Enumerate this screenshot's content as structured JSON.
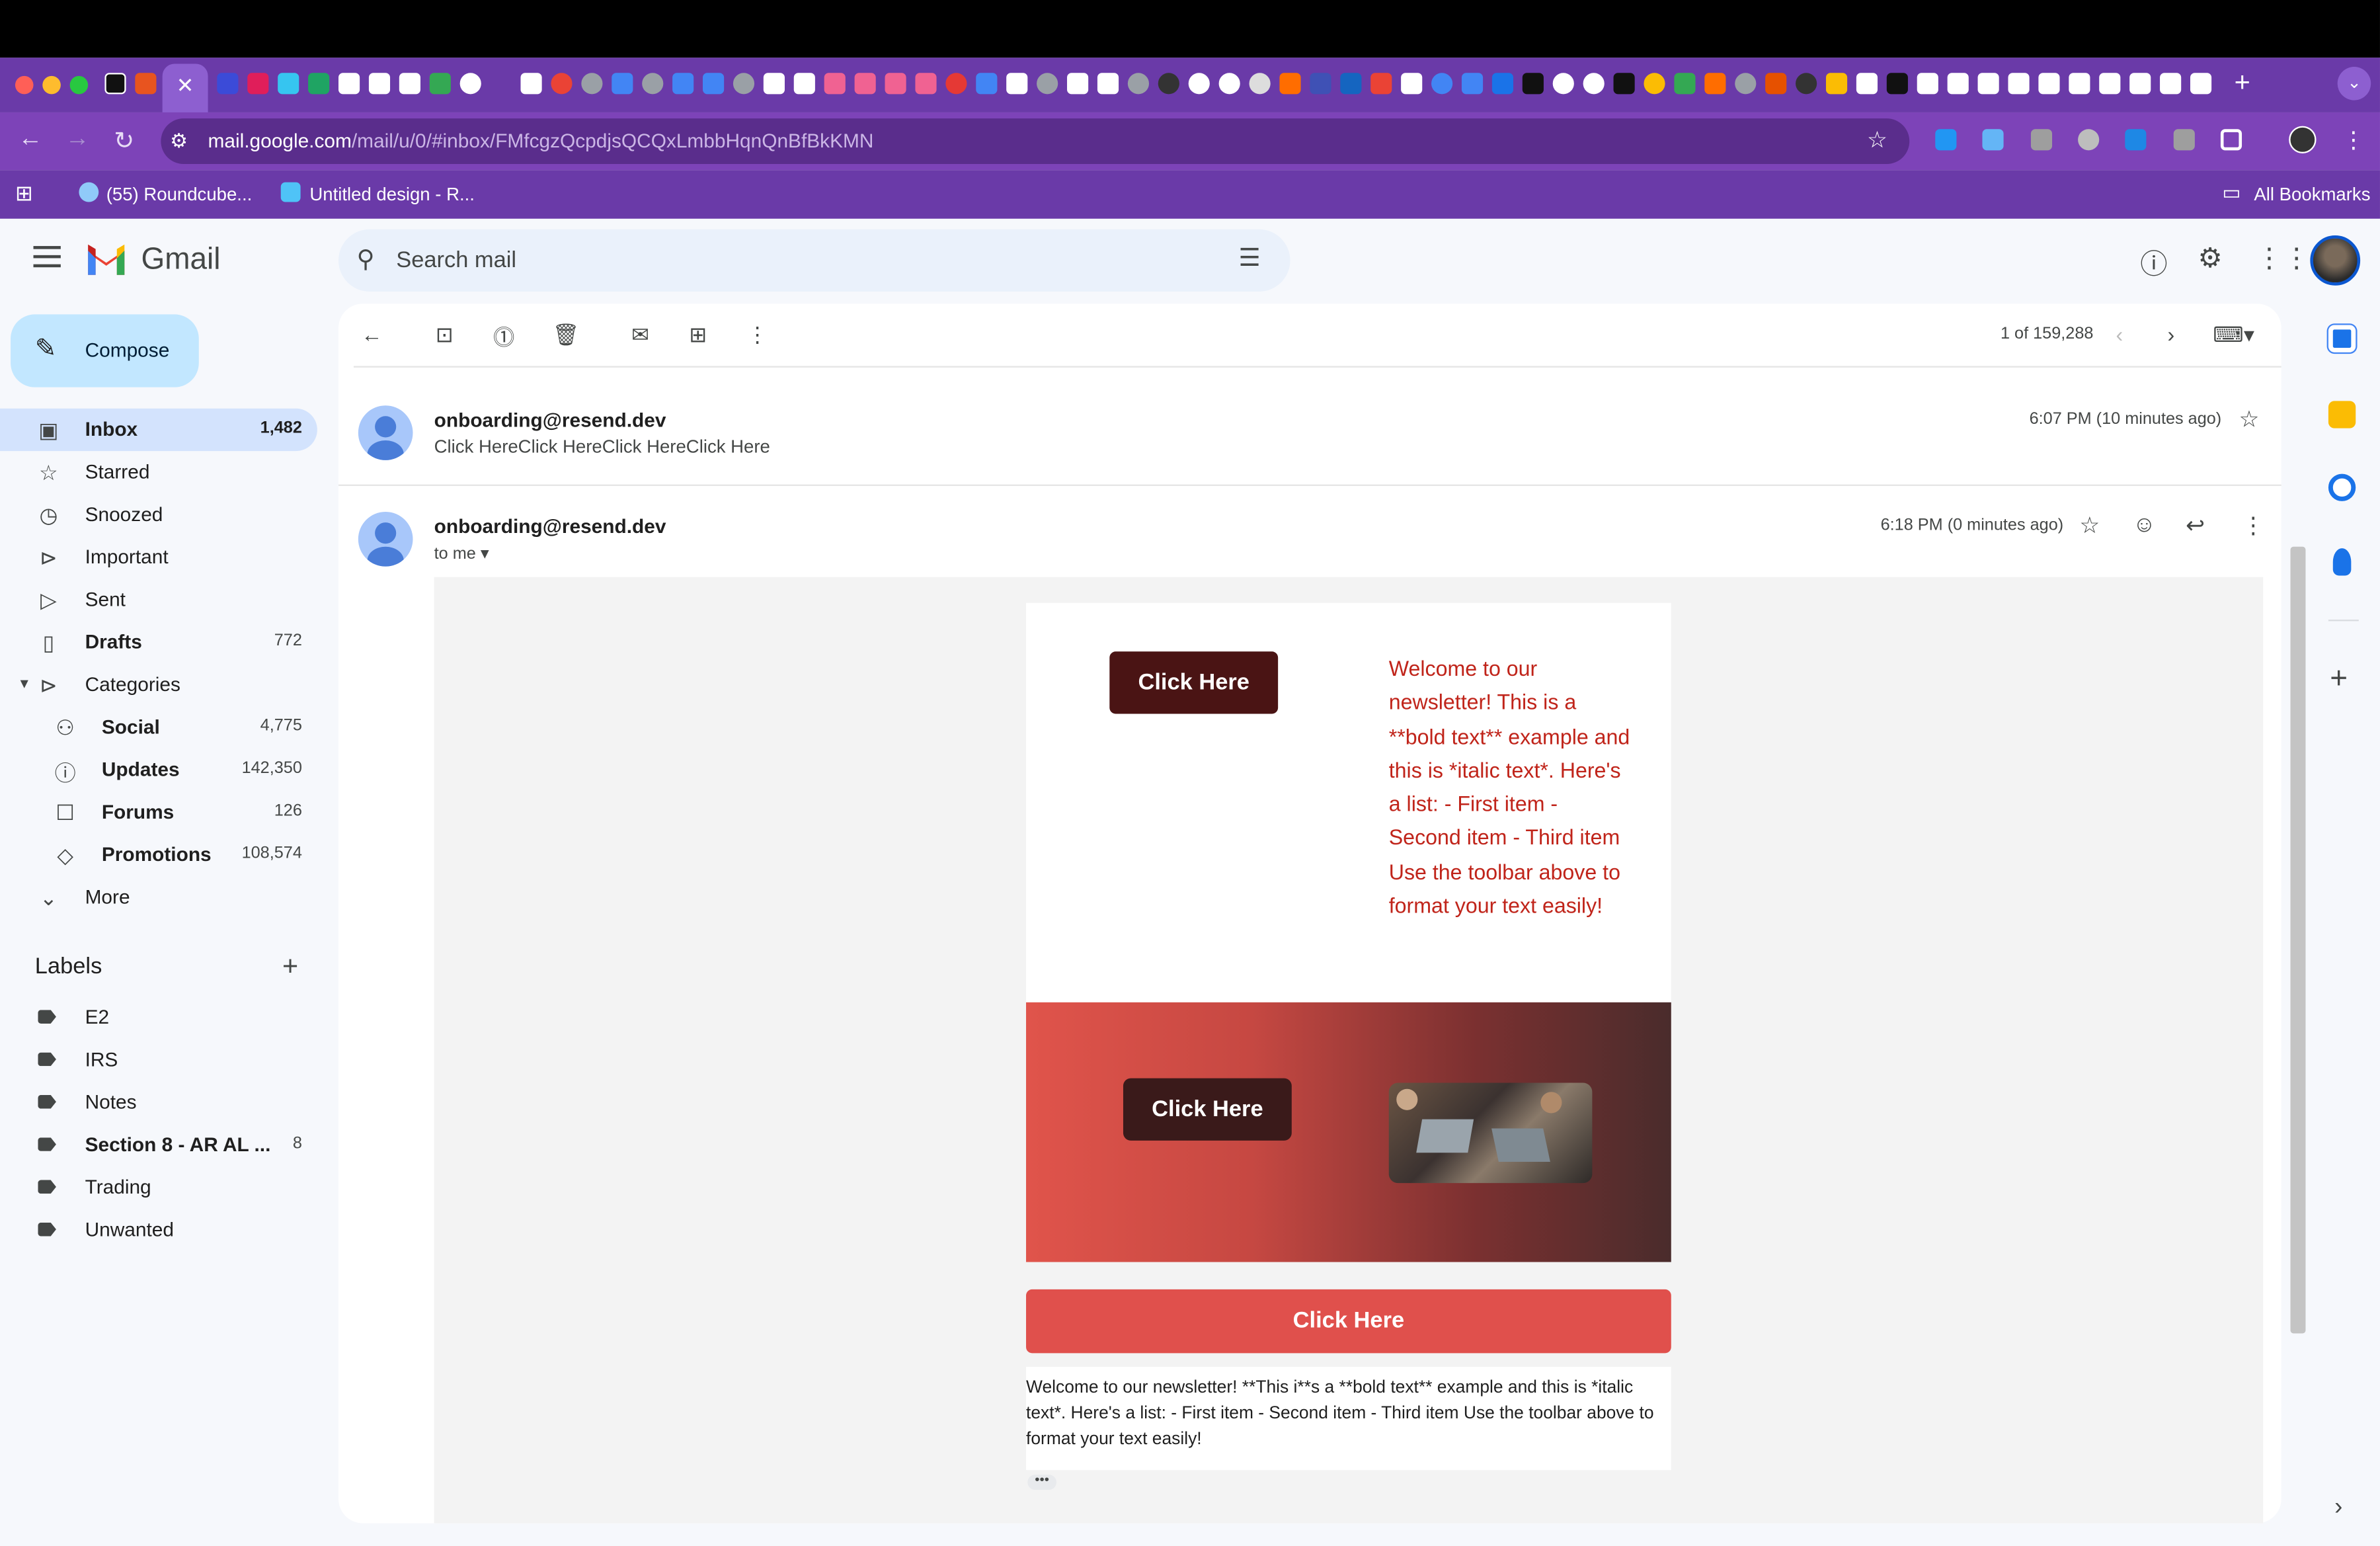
{
  "browser": {
    "active_tab_close": "✕",
    "new_tab": "+",
    "url_host": "mail.google.com",
    "url_path": "/mail/u/0/#inbox/FMfcgzQcpdjsQCQxLmbbHqnQnBfBkKMN",
    "bookmarks": [
      "(55) Roundcube...",
      "Untitled design - R..."
    ],
    "all_bookmarks": "All Bookmarks"
  },
  "gmail": {
    "brand": "Gmail",
    "search_placeholder": "Search mail",
    "compose": "Compose"
  },
  "sidebar": {
    "items": [
      {
        "label": "Inbox",
        "count": "1,482"
      },
      {
        "label": "Starred",
        "count": ""
      },
      {
        "label": "Snoozed",
        "count": ""
      },
      {
        "label": "Important",
        "count": ""
      },
      {
        "label": "Sent",
        "count": ""
      },
      {
        "label": "Drafts",
        "count": "772"
      },
      {
        "label": "Categories",
        "count": ""
      }
    ],
    "categories": [
      {
        "label": "Social",
        "count": "4,775"
      },
      {
        "label": "Updates",
        "count": "142,350"
      },
      {
        "label": "Forums",
        "count": "126"
      },
      {
        "label": "Promotions",
        "count": "108,574"
      }
    ],
    "more": "More",
    "labels_heading": "Labels",
    "labels": [
      {
        "label": "E2",
        "count": ""
      },
      {
        "label": "IRS",
        "count": ""
      },
      {
        "label": "Notes",
        "count": ""
      },
      {
        "label": "Section 8 - AR AL ...",
        "count": "8"
      },
      {
        "label": "Trading",
        "count": ""
      },
      {
        "label": "Unwanted",
        "count": ""
      }
    ]
  },
  "toolbar": {
    "pager": "1 of 159,288"
  },
  "thread": {
    "msg1": {
      "sender": "onboarding@resend.dev",
      "snippet": "Click HereClick HereClick HereClick Here",
      "time": "6:07 PM (10 minutes ago)"
    },
    "msg2": {
      "sender": "onboarding@resend.dev",
      "to": "to me",
      "time": "6:18 PM (0 minutes ago)"
    }
  },
  "email": {
    "button1": "Click Here",
    "welcome_red": "Welcome to our newsletter! This is a **bold text** example and this is *italic text*. Here's a list: - First item - Second item - Third item Use the toolbar above to format your text easily!",
    "button2": "Click Here",
    "button3": "Click Here",
    "welcome_black": "Welcome to our newsletter! **This i**s a **bold text** example and this is *italic text*. Here's a list: - First item - Second item - Third item Use the toolbar above to format your text easily!",
    "ellipsis": "•••"
  },
  "colors": {
    "browser_frame": "#6a3aa8",
    "compose_bg": "#c2e7ff",
    "active_nav": "#d3e3fd",
    "button_dark": "#4a1414",
    "button_red": "#e0504c",
    "text_red": "#c0241a"
  }
}
